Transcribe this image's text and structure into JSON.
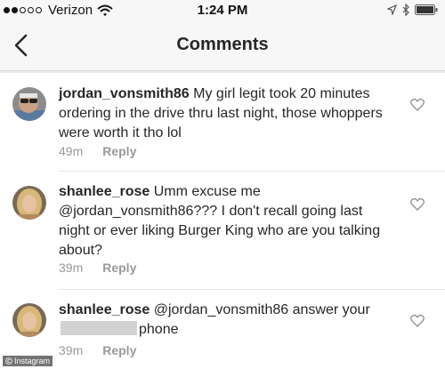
{
  "status_bar": {
    "carrier": "Verizon",
    "time": "1:24 PM",
    "signal_full_dots": 2,
    "signal_total_dots": 5,
    "icons": [
      "wifi-icon",
      "location-arrow-icon",
      "bluetooth-icon",
      "battery-icon"
    ]
  },
  "nav": {
    "title": "Comments",
    "back_icon": "chevron-left-icon"
  },
  "comments": [
    {
      "username": "jordan_vonsmith86",
      "text": "My girl legit took 20 minutes ordering in the drive thru last night, those whoppers were worth it tho lol",
      "time": "49m",
      "reply_label": "Reply"
    },
    {
      "username": "shanlee_rose",
      "text": "Umm excuse me @jordan_vonsmith86??? I don't recall going last night or ever liking Burger King who are you talking about?",
      "time": "39m",
      "reply_label": "Reply"
    },
    {
      "username": "shanlee_rose",
      "mention": "@jordan_vonsmith86",
      "text_before": "answer your",
      "text_after": "phone",
      "time": "39m",
      "reply_label": "Reply"
    }
  ],
  "watermark": "Instagram",
  "colors": {
    "background": "#ffffff",
    "bar_background": "#f7f7f7",
    "text": "#262626",
    "meta": "#999999",
    "redaction": "#d2d2d2"
  }
}
